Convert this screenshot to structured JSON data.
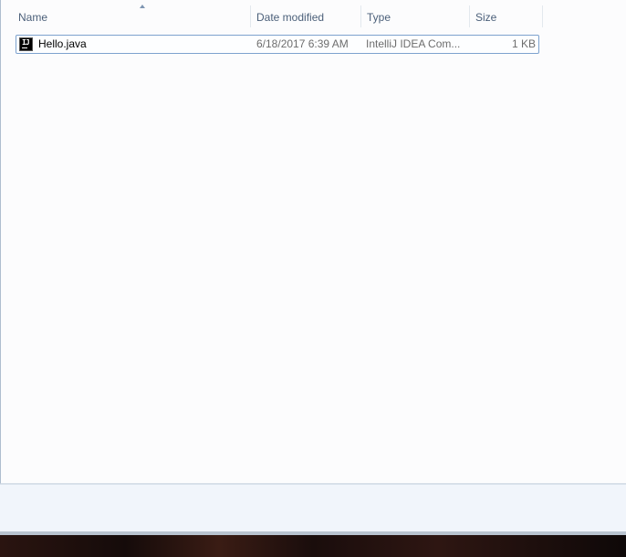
{
  "columns": {
    "name": "Name",
    "date_modified": "Date modified",
    "type": "Type",
    "size": "Size"
  },
  "sort": {
    "column": "name",
    "icon": "sort-ascending-icon"
  },
  "files": [
    {
      "name": "Hello.java",
      "date_modified": "6/18/2017 6:39 AM",
      "type": "IntelliJ IDEA Com...",
      "size": "1 KB",
      "icon": "intellij-file-icon"
    }
  ],
  "colors": {
    "header_text": "#4c607a",
    "selection_border": "#7da2ce",
    "meta_text": "#6d6d6d"
  }
}
